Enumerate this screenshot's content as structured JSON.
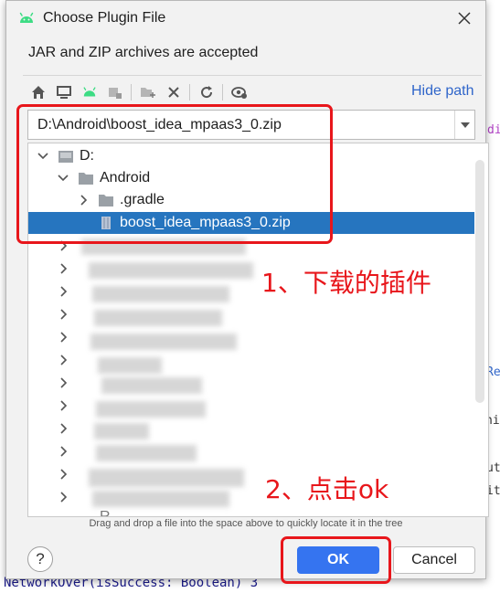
{
  "dialog": {
    "title": "Choose Plugin File",
    "subtitle": "JAR and ZIP archives are accepted",
    "hide_path_label": "Hide path",
    "path_value": "D:\\Android\\boost_idea_mpaas3_0.zip",
    "hint": "Drag and drop a file into the space above to quickly locate it in the tree",
    "help_label": "?",
    "ok_label": "OK",
    "cancel_label": "Cancel"
  },
  "toolbar": {
    "icons": [
      "home-icon",
      "desktop-icon",
      "android-icon",
      "module-icon",
      "new-folder-icon",
      "delete-icon",
      "refresh-icon",
      "show-hidden-icon"
    ]
  },
  "tree": {
    "drive": "D:",
    "folder": "Android",
    "subfolder": ".gradle",
    "selected_file": "boost_idea_mpaas3_0.zip",
    "partial_label": "R"
  },
  "annotations": {
    "step1": "1、下载的插件",
    "step2": "2、点击ok"
  },
  "background": {
    "bottom_code": "NetworkOver(isSuccess: Boolean) 3",
    "code_fragments": [
      "Re",
      "ni",
      "ut",
      "it",
      "di"
    ]
  },
  "colors": {
    "accent": "#3574f0",
    "selection": "#2675bf",
    "annotation_red": "#e8161b",
    "link": "#2f65ca",
    "android_green": "#3ddc84"
  }
}
